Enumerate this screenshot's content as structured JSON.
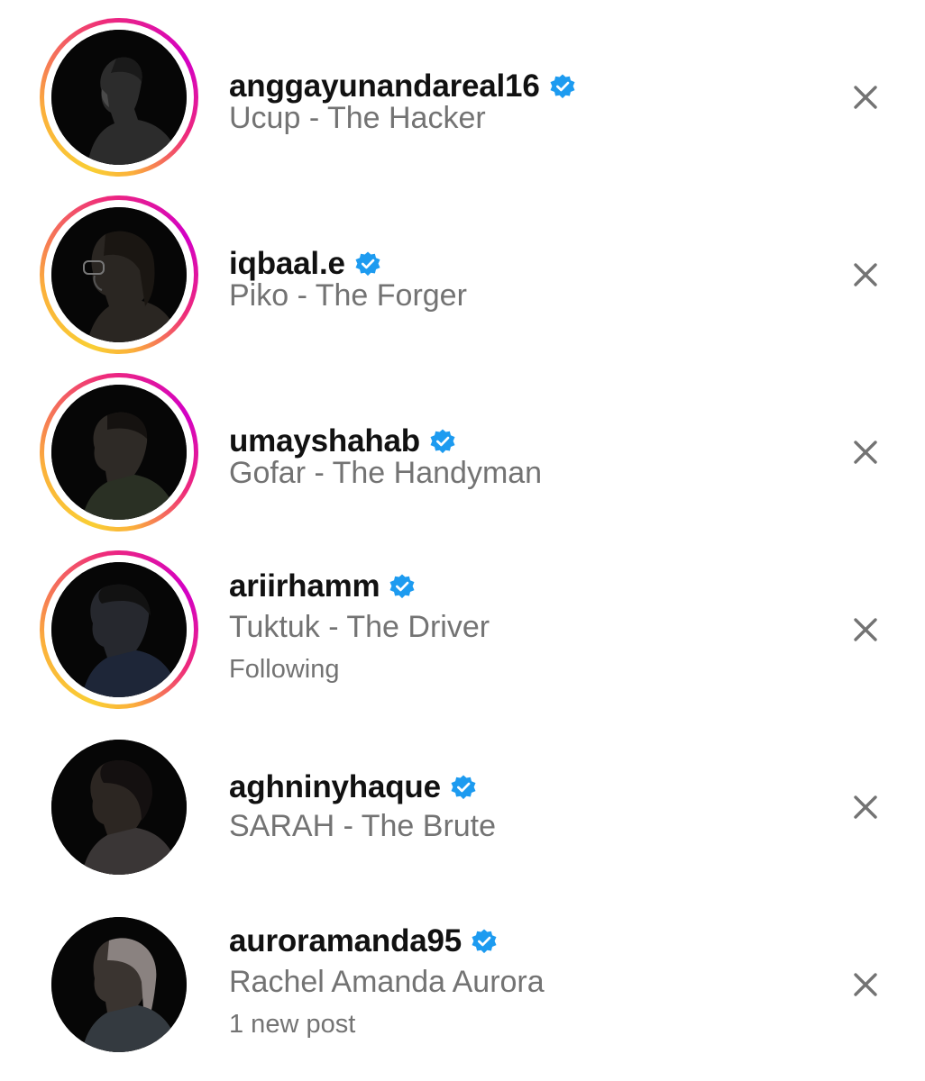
{
  "suggestions": [
    {
      "username": "anggayunandareal16",
      "subtitle": "Ucup - The Hacker",
      "meta": "",
      "verified": true,
      "has_story": true,
      "avatar_icon": "profile-photo-silhouette"
    },
    {
      "username": "iqbaal.e",
      "subtitle": "Piko - The Forger",
      "meta": "",
      "verified": true,
      "has_story": true,
      "avatar_icon": "profile-photo-silhouette"
    },
    {
      "username": "umayshahab",
      "subtitle": "Gofar - The Handyman",
      "meta": "",
      "verified": true,
      "has_story": true,
      "avatar_icon": "profile-photo-silhouette"
    },
    {
      "username": "ariirhamm",
      "subtitle": "Tuktuk - The Driver",
      "meta": "Following",
      "verified": true,
      "has_story": true,
      "avatar_icon": "profile-photo-silhouette"
    },
    {
      "username": "aghninyhaque",
      "subtitle": "SARAH - The Brute",
      "meta": "",
      "verified": true,
      "has_story": false,
      "avatar_icon": "profile-photo-silhouette"
    },
    {
      "username": "auroramanda95",
      "subtitle": "Rachel Amanda Aurora",
      "meta": "1 new post",
      "verified": true,
      "has_story": false,
      "avatar_icon": "profile-photo-silhouette"
    }
  ],
  "icons": {
    "verified": "verified-badge-icon",
    "dismiss": "close-icon"
  },
  "colors": {
    "verified_blue": "#1d9bf0",
    "username": "#111111",
    "secondary_text": "#737373",
    "dismiss": "#737373",
    "story_ring_start": "#f9ce34",
    "story_ring_mid": "#ee2a7b",
    "story_ring_end": "#d300c5"
  }
}
